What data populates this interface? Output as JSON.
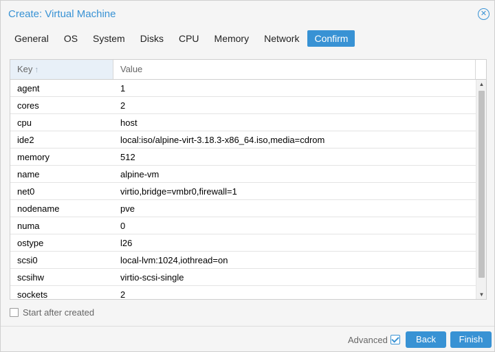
{
  "dialog": {
    "title": "Create: Virtual Machine",
    "close_icon": "close-icon"
  },
  "tabs": [
    {
      "label": "General",
      "active": false
    },
    {
      "label": "OS",
      "active": false
    },
    {
      "label": "System",
      "active": false
    },
    {
      "label": "Disks",
      "active": false
    },
    {
      "label": "CPU",
      "active": false
    },
    {
      "label": "Memory",
      "active": false
    },
    {
      "label": "Network",
      "active": false
    },
    {
      "label": "Confirm",
      "active": true
    }
  ],
  "grid": {
    "headers": {
      "key": "Key",
      "key_sort_icon": "↑",
      "value": "Value"
    },
    "rows": [
      {
        "key": "agent",
        "value": "1"
      },
      {
        "key": "cores",
        "value": "2"
      },
      {
        "key": "cpu",
        "value": "host"
      },
      {
        "key": "ide2",
        "value": "local:iso/alpine-virt-3.18.3-x86_64.iso,media=cdrom"
      },
      {
        "key": "memory",
        "value": "512"
      },
      {
        "key": "name",
        "value": "alpine-vm"
      },
      {
        "key": "net0",
        "value": "virtio,bridge=vmbr0,firewall=1"
      },
      {
        "key": "nodename",
        "value": "pve"
      },
      {
        "key": "numa",
        "value": "0"
      },
      {
        "key": "ostype",
        "value": "l26"
      },
      {
        "key": "scsi0",
        "value": "local-lvm:1024,iothread=on"
      },
      {
        "key": "scsihw",
        "value": "virtio-scsi-single"
      },
      {
        "key": "sockets",
        "value": "2"
      }
    ]
  },
  "start_after_created": {
    "label": "Start after created",
    "checked": false
  },
  "footer": {
    "advanced_label": "Advanced",
    "advanced_checked": true,
    "back_label": "Back",
    "finish_label": "Finish"
  },
  "colors": {
    "accent": "#3892d4",
    "header_key_bg": "#e8f0f8"
  }
}
